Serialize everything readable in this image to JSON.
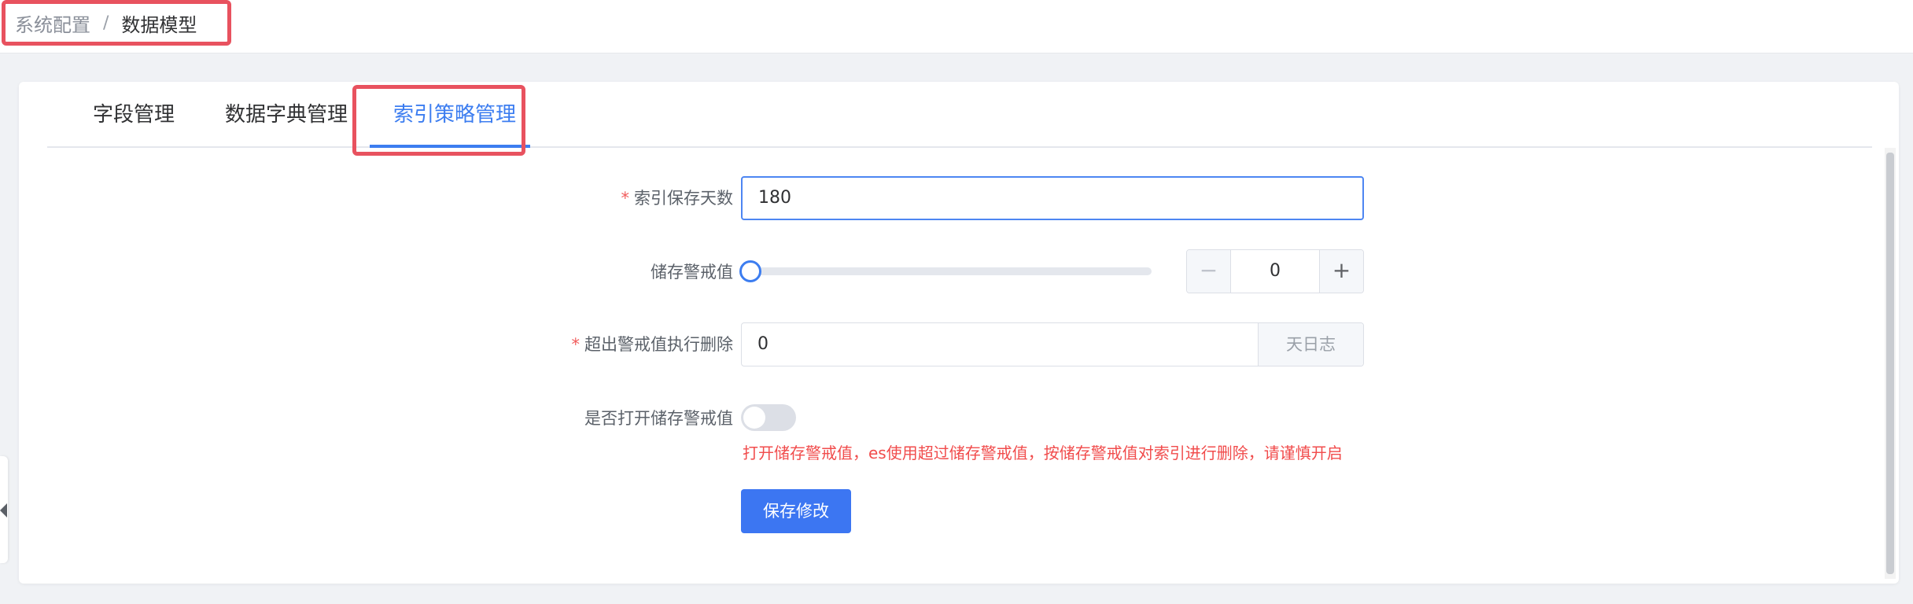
{
  "breadcrumb": {
    "parent": "系统配置",
    "separator": "/",
    "current": "数据模型"
  },
  "tabs": [
    {
      "label": "字段管理",
      "active": false
    },
    {
      "label": "数据字典管理",
      "active": false
    },
    {
      "label": "索引策略管理",
      "active": true
    }
  ],
  "form": {
    "retention_days": {
      "required": true,
      "required_mark": "*",
      "label": "索引保存天数",
      "value": "180"
    },
    "storage_threshold": {
      "label": "储存警戒值",
      "slider_level": 0,
      "stepper_value": "0",
      "minus_symbol": "−",
      "plus_symbol": "+"
    },
    "delete_over_threshold": {
      "required": true,
      "required_mark": "*",
      "label": "超出警戒值执行删除",
      "value": "0",
      "suffix": "天日志"
    },
    "enable_threshold": {
      "label": "是否打开储存警戒值",
      "enabled": false,
      "warning": "打开储存警戒值，es使用超过储存警戒值，按储存警戒值对索引进行删除，请谨慎开启"
    },
    "save_button": "保存修改"
  },
  "colors": {
    "accent": "#3c7df0",
    "highlight_frame": "#e8525f",
    "warning_text": "#f14c4c"
  }
}
